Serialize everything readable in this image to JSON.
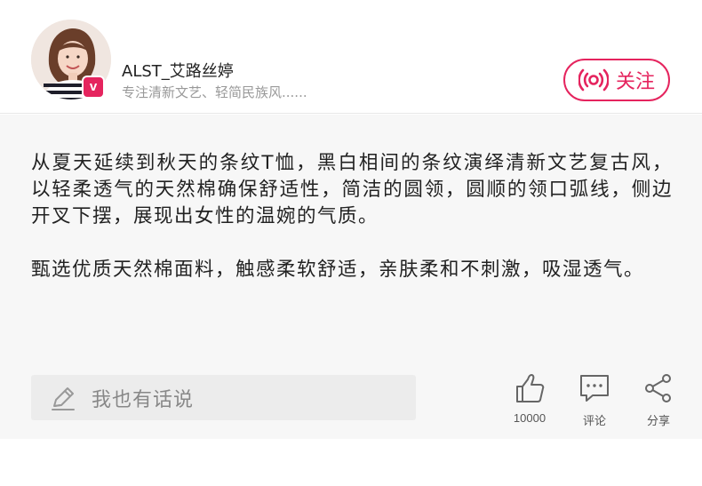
{
  "author": {
    "name": "ALST_艾路丝婷",
    "bio": "专注清新文艺、轻简民族风......",
    "verified_badge": "v"
  },
  "follow": {
    "label": "关注",
    "icon": "broadcast-icon",
    "color": "#e5245e"
  },
  "post": {
    "paragraphs": [
      "从夏天延续到秋天的条纹T恤，黑白相间的条纹演绎清新文艺复古风，以轻柔透气的天然棉确保舒适性，简洁的圆领，圆顺的领口弧线，侧边开叉下摆，展现出女性的温婉的气质。",
      "甄选优质天然棉面料，触感柔软舒适，亲肤柔和不刺激，吸湿透气。"
    ]
  },
  "comment_input": {
    "placeholder": "我也有话说",
    "icon": "pencil-icon"
  },
  "actions": {
    "like": {
      "label": "10000",
      "icon": "thumbs-up-icon"
    },
    "comment": {
      "label": "评论",
      "icon": "comment-icon"
    },
    "share": {
      "label": "分享",
      "icon": "share-icon"
    }
  }
}
